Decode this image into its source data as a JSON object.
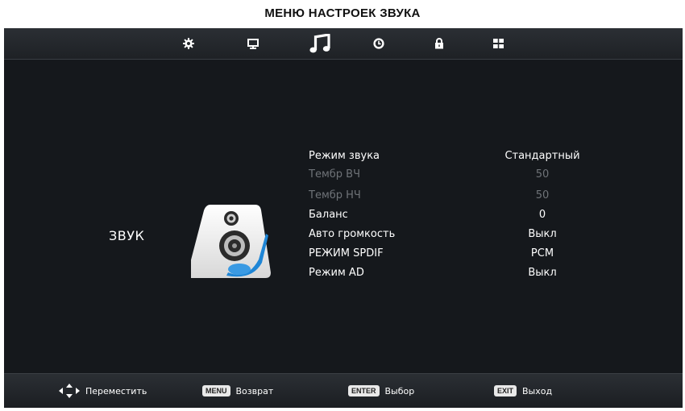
{
  "page": {
    "title": "МЕНЮ НАСТРОЕК ЗВУКА"
  },
  "tabs": [
    {
      "icon": "gear-icon",
      "active": false
    },
    {
      "icon": "monitor-icon",
      "active": false
    },
    {
      "icon": "music-note-icon",
      "active": true
    },
    {
      "icon": "clock-icon",
      "active": false
    },
    {
      "icon": "lock-icon",
      "active": false
    },
    {
      "icon": "grid-icon",
      "active": false
    }
  ],
  "section": {
    "label": "ЗВУК",
    "icon": "speaker-icon"
  },
  "menu": {
    "items": [
      {
        "label": "Режим звука",
        "value": "Стандартный",
        "enabled": true
      },
      {
        "label": "Тембр ВЧ",
        "value": "50",
        "enabled": false
      },
      {
        "label": "Тембр НЧ",
        "value": "50",
        "enabled": false
      },
      {
        "label": "Баланс",
        "value": "0",
        "enabled": true
      },
      {
        "label": "Авто громкость",
        "value": "Выкл",
        "enabled": true
      },
      {
        "label": "РЕЖИМ SPDIF",
        "value": "PCM",
        "enabled": true
      },
      {
        "label": "Режим AD",
        "value": "Выкл",
        "enabled": true
      }
    ]
  },
  "footer": {
    "move": {
      "icon": "dpad-arrows-icon",
      "label": "Переместить"
    },
    "back": {
      "key": "MENU",
      "label": "Возврат"
    },
    "select": {
      "key": "ENTER",
      "label": "Выбор"
    },
    "exit": {
      "key": "EXIT",
      "label": "Выход"
    }
  },
  "colors": {
    "background": "#15181c",
    "bar": "#2b2f34",
    "text": "#ffffff",
    "disabled_text": "#6f7378",
    "accent": "#3a8fd6"
  }
}
